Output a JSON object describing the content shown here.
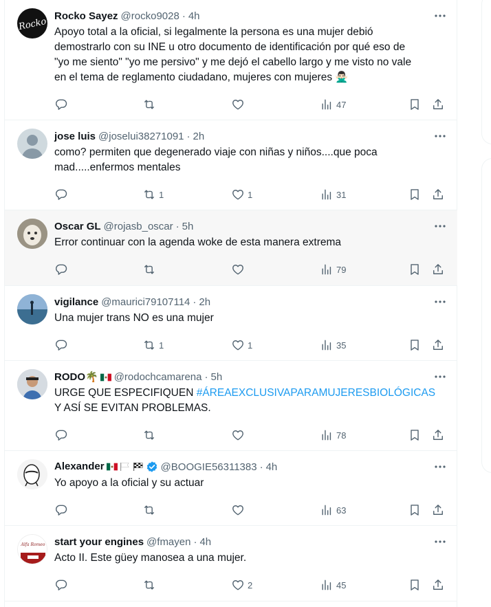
{
  "tweets": [
    {
      "name": "Rocko Sayez",
      "handle": "@rocko9028",
      "time": "4h",
      "lines": [
        "Apoyo total a la oficial, si legalmente la persona es una mujer debió",
        "demostrarlo con su INE u otro documento de identificación por qué eso de",
        "\"yo me siento\" \"yo me persivo\" y me dejó el cabello largo y me visto no vale",
        "en el tema de reglamento ciudadano, mujeres con mujeres 🙅🏻‍♂️"
      ],
      "replies": "",
      "retweets": "",
      "likes": "",
      "views": "47"
    },
    {
      "name": "jose luis",
      "handle": "@joselui38271091",
      "time": "2h",
      "lines": [
        "como? permiten que degenerado viaje con niñas y niños....que poca",
        "mad.....enfermos mentales"
      ],
      "replies": "",
      "retweets": "1",
      "likes": "1",
      "views": "31"
    },
    {
      "name": "Oscar GL",
      "handle": "@rojasb_oscar",
      "time": "5h",
      "lines": [
        "Error continuar con la agenda woke de esta manera extrema"
      ],
      "replies": "",
      "retweets": "",
      "likes": "",
      "views": "79"
    },
    {
      "name": "vigilance",
      "handle": "@maurici79107114",
      "time": "2h",
      "lines": [
        "Una mujer trans NO es una mujer"
      ],
      "replies": "",
      "retweets": "1",
      "likes": "1",
      "views": "35"
    },
    {
      "name": "RODO",
      "name_emoji": "🌴",
      "handle": "@rodochcamarena",
      "time": "5h",
      "line1_text": "URGE QUE ESPECIFIQUEN ",
      "line1_hashtag": "#ÁREAEXCLUSIVAPARAMUJERESBIOLÓGICAS",
      "line2_text": "Y ASÍ SE EVITAN PROBLEMAS.",
      "replies": "",
      "retweets": "",
      "likes": "",
      "views": "78"
    },
    {
      "name": "Alexander",
      "handle": "@BOOGIE56311383",
      "time": "4h",
      "lines": [
        "Yo apoyo a la oficial y su actuar"
      ],
      "replies": "",
      "retweets": "",
      "likes": "",
      "views": "63"
    },
    {
      "name": "start your engines",
      "handle": "@fmayen",
      "time": "4h",
      "lines": [
        "Acto II.  Este güey manosea a una mujer."
      ],
      "replies": "",
      "retweets": "",
      "likes": "2",
      "views": "45"
    }
  ],
  "icons": {
    "reply": "reply-icon",
    "retweet": "retweet-icon",
    "like": "heart-icon",
    "views": "views-icon",
    "bookmark": "bookmark-icon",
    "share": "share-icon",
    "more": "more-icon"
  },
  "colors": {
    "text": "#0f1419",
    "secondary": "#536471",
    "link": "#1d9bf0",
    "verified": "#1d9bf0",
    "border": "#eff3f4",
    "hover_bg": "#f7f7f7"
  }
}
